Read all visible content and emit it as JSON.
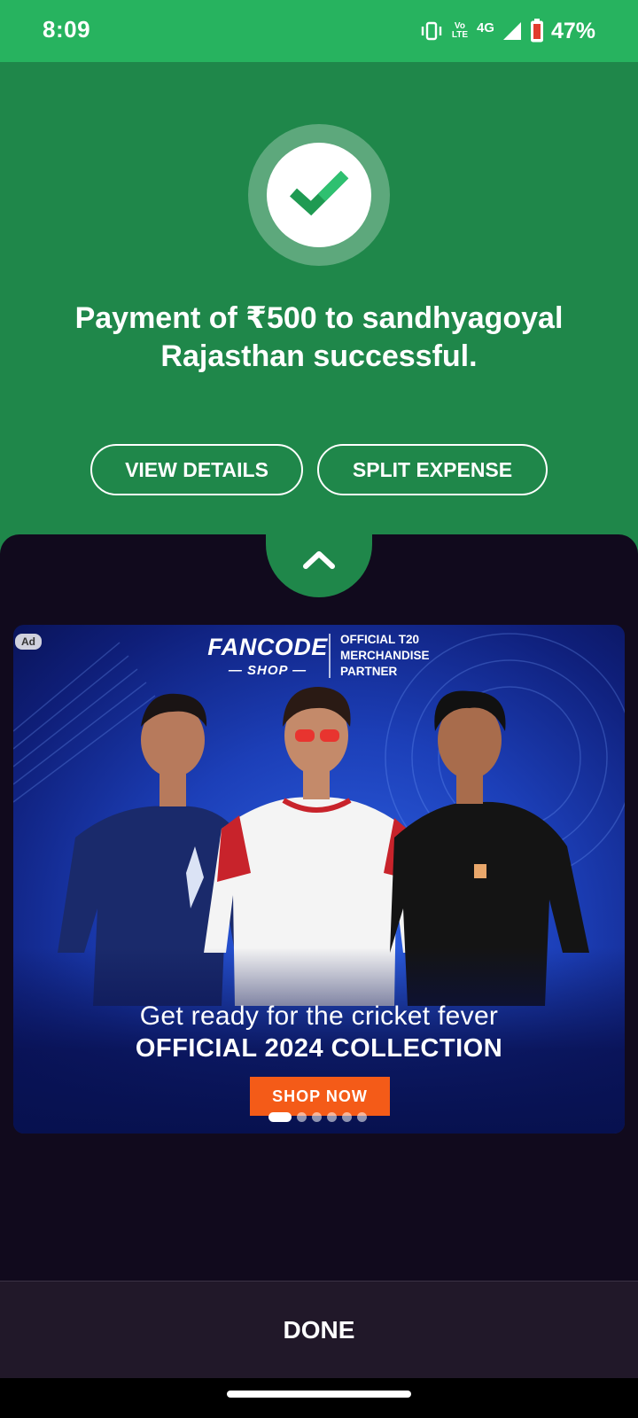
{
  "status_bar": {
    "time": "8:09",
    "lte_label": "Vo LTE",
    "network": "4G",
    "battery": "47%",
    "icons": [
      "vibrate-icon",
      "volte-icon",
      "signal-icon",
      "battery-icon"
    ]
  },
  "payment": {
    "status_icon": "check-icon",
    "message": "Payment of ₹500 to sandhyagoyal Rajasthan successful.",
    "view_details_label": "VIEW DETAILS",
    "split_expense_label": "SPLIT EXPENSE",
    "expand_icon": "chevron-up-icon"
  },
  "ad": {
    "badge": "Ad",
    "brand": "FANCODE",
    "brand_sub": "— SHOP —",
    "partner_text": "OFFICIAL T20 MERCHANDISE PARTNER",
    "headline": "Get ready for the cricket fever",
    "subheadline": "OFFICIAL 2024 COLLECTION",
    "cta_label": "SHOP NOW",
    "slide_count": 6,
    "active_slide": 1
  },
  "footer": {
    "done_label": "DONE"
  },
  "colors": {
    "status_green": "#27b35f",
    "header_green": "#1f874a",
    "sheet_bg": "#110a1d",
    "cta_orange": "#f45b18"
  }
}
